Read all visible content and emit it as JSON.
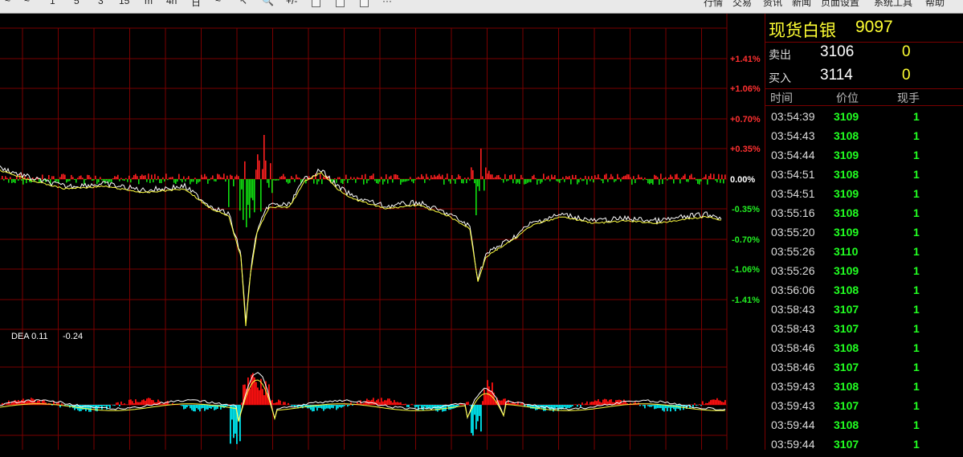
{
  "toolbar": {
    "left_items": [
      "1",
      "5",
      "3",
      "15",
      "m",
      "4h",
      "日",
      "~",
      "↖",
      "🔍",
      "+/-"
    ],
    "right_items": [
      "行情",
      "交易",
      "资讯",
      "新闻",
      "页面设置",
      "系统工具",
      "帮助"
    ]
  },
  "chart": {
    "grid_color": "#7a0000",
    "up_color": "#ff2020",
    "down_color": "#10e010",
    "macd_pos_color": "#ff1010",
    "macd_neg_color": "#00e5ee",
    "percent_labels_up": [
      "+1.41%",
      "+1.06%",
      "+0.70%",
      "+0.35%"
    ],
    "percent_label_zero": "0.00%",
    "percent_labels_down": [
      "-0.35%",
      "-0.70%",
      "-1.06%",
      "-1.41%"
    ],
    "macd_label": "DEA 0.11",
    "macd_value": "-0.24"
  },
  "quote": {
    "name": "现货白银",
    "code": "9097",
    "sell_label": "卖出",
    "sell_price": "3106",
    "sell_volume": "0",
    "buy_label": "买入",
    "buy_price": "3114",
    "buy_volume": "0"
  },
  "ticks": {
    "headers": [
      "时间",
      "价位",
      "现手"
    ],
    "rows": [
      {
        "time": "03:54:39",
        "price": "3109",
        "volume": "1"
      },
      {
        "time": "03:54:43",
        "price": "3108",
        "volume": "1"
      },
      {
        "time": "03:54:44",
        "price": "3109",
        "volume": "1"
      },
      {
        "time": "03:54:51",
        "price": "3108",
        "volume": "1"
      },
      {
        "time": "03:54:51",
        "price": "3109",
        "volume": "1"
      },
      {
        "time": "03:55:16",
        "price": "3108",
        "volume": "1"
      },
      {
        "time": "03:55:20",
        "price": "3109",
        "volume": "1"
      },
      {
        "time": "03:55:26",
        "price": "3110",
        "volume": "1"
      },
      {
        "time": "03:55:26",
        "price": "3109",
        "volume": "1"
      },
      {
        "time": "03:56:06",
        "price": "3108",
        "volume": "1"
      },
      {
        "time": "03:58:43",
        "price": "3107",
        "volume": "1"
      },
      {
        "time": "03:58:43",
        "price": "3107",
        "volume": "1"
      },
      {
        "time": "03:58:46",
        "price": "3108",
        "volume": "1"
      },
      {
        "time": "03:58:46",
        "price": "3107",
        "volume": "1"
      },
      {
        "time": "03:59:43",
        "price": "3108",
        "volume": "1"
      },
      {
        "time": "03:59:43",
        "price": "3107",
        "volume": "1"
      },
      {
        "time": "03:59:44",
        "price": "3108",
        "volume": "1"
      },
      {
        "time": "03:59:44",
        "price": "3107",
        "volume": "1"
      }
    ]
  }
}
